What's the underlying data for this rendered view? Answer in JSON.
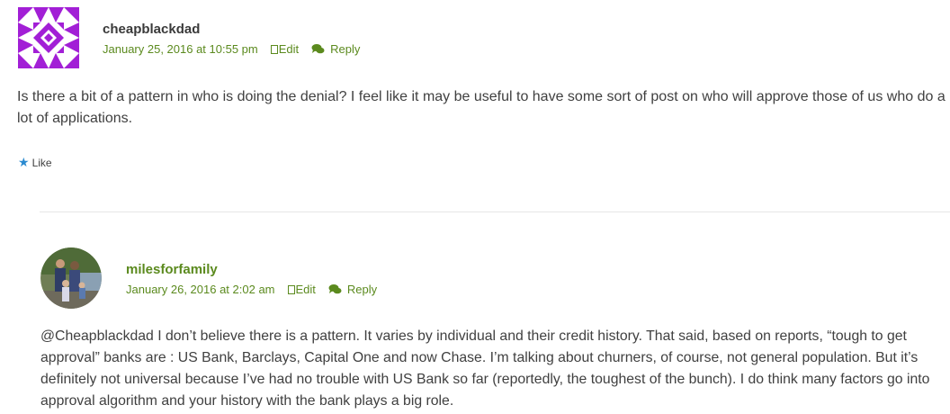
{
  "comments": [
    {
      "author": "cheapblackdad",
      "date": "January 25, 2016 at 10:55 pm",
      "edit_label": "Edit",
      "reply_label": "Reply",
      "text": "Is there a bit of a pattern in who is doing the denial? I feel like it may be useful to have some sort of post on who will approve those of us who do a lot of applications.",
      "like_label": "Like"
    },
    {
      "author": "milesforfamily",
      "date": "January 26, 2016 at 2:02 am",
      "edit_label": "Edit",
      "reply_label": "Reply",
      "text": "@Cheapblackdad I don’t believe there is a pattern. It varies by individual and their credit history. That said, based on reports, “tough to get approval” banks are : US Bank, Barclays, Capital One and now Chase. I’m talking about churners, of course, not general population. But it’s definitely not universal because I’ve had no trouble with US Bank so far (reportedly, the toughest of the bunch). I do think many factors go into approval algorithm and your history with the bank plays a big role."
    }
  ],
  "colors": {
    "link": "#5b8a1e",
    "text": "#404040",
    "like_star": "#2a8ad0",
    "identicon": "#a21fd6"
  },
  "icons": {
    "avatar1": "identicon-avatar",
    "avatar2": "family-photo-avatar",
    "edit": "edit-icon",
    "reply": "reply-bubble-icon",
    "like": "star-icon"
  }
}
